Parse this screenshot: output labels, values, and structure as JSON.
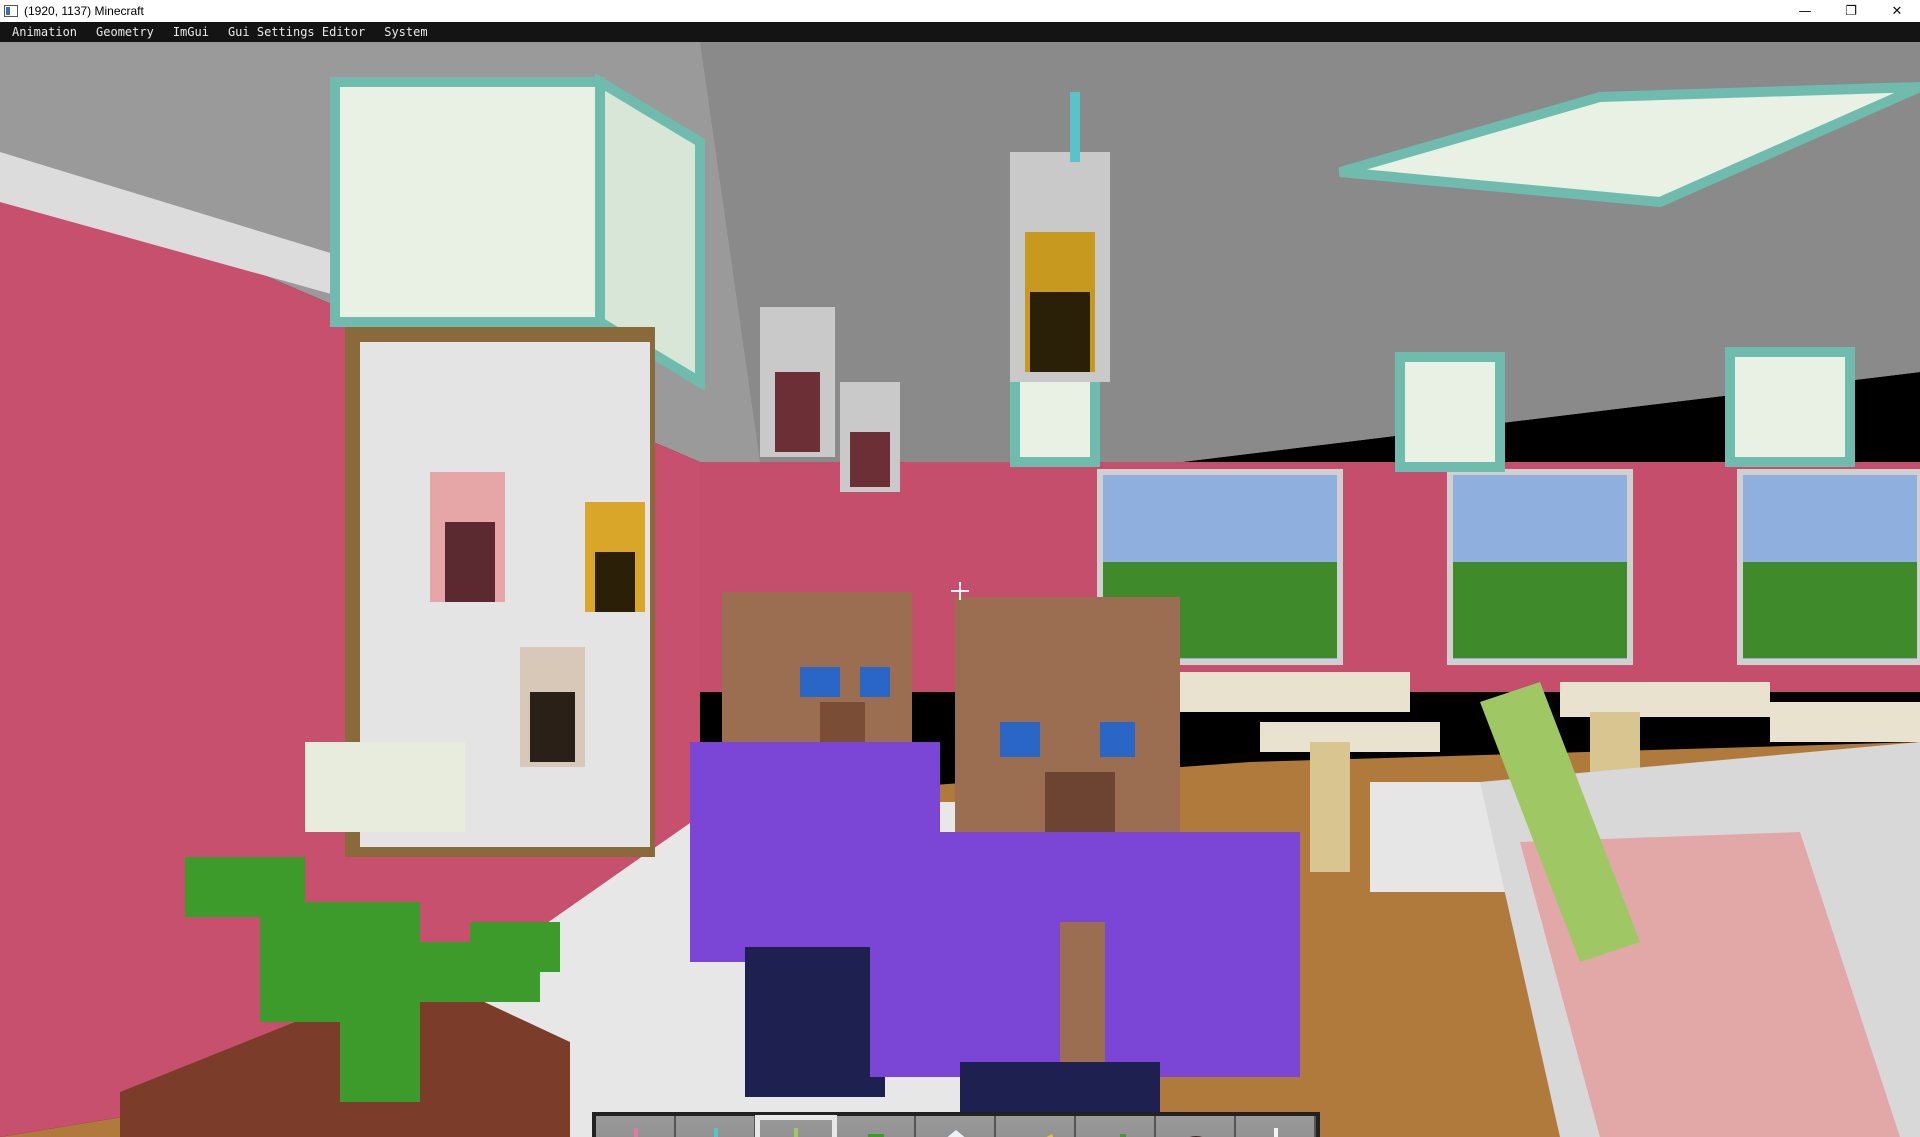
{
  "window": {
    "title": "(1920, 1137) Minecraft",
    "controls": {
      "minimize": "—",
      "restore": "❐",
      "close": "✕"
    }
  },
  "menubar": {
    "items": [
      {
        "label": "Animation"
      },
      {
        "label": "Geometry"
      },
      {
        "label": "ImGui"
      },
      {
        "label": "Gui Settings Editor"
      },
      {
        "label": "System"
      }
    ]
  },
  "hotbar": {
    "selected_index": 2,
    "slots": [
      {
        "icon": "pink-boba-tea-icon"
      },
      {
        "icon": "mango-boba-tea-icon"
      },
      {
        "icon": "strawberry-boba-tea-icon"
      },
      {
        "icon": "strawberry-icon"
      },
      {
        "icon": "milk-carton-icon"
      },
      {
        "icon": "mango-icon"
      },
      {
        "icon": "tea-leaf-icon"
      },
      {
        "icon": "coconut-icon"
      },
      {
        "icon": "empty-cup-icon"
      }
    ]
  },
  "colors": {
    "wall_pink": "#c8506f",
    "ceiling_gray": "#8f8f8f",
    "villager_robe": "#7b45d6",
    "floor_wood": "#b07a3c"
  }
}
